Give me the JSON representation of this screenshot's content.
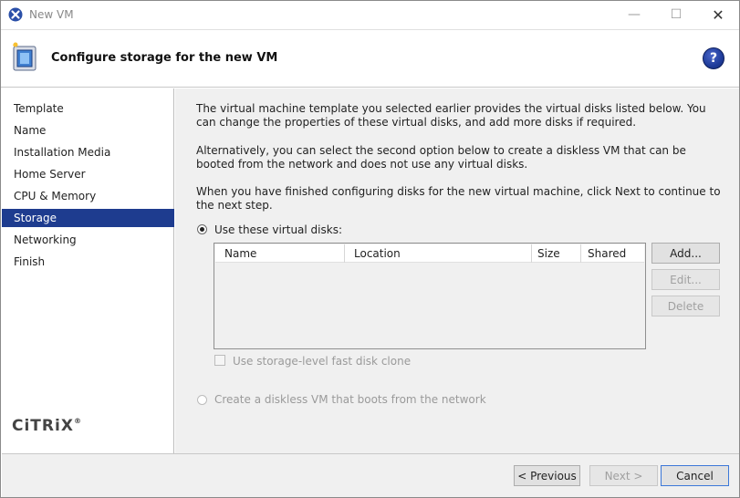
{
  "window": {
    "title": "New VM",
    "minimize_glyph": "—",
    "maximize_glyph": "☐",
    "close_glyph": "✕"
  },
  "header": {
    "title": "Configure storage for the new VM",
    "help_label": "?"
  },
  "sidebar": {
    "items": [
      {
        "label": "Template"
      },
      {
        "label": "Name"
      },
      {
        "label": "Installation Media"
      },
      {
        "label": "Home Server"
      },
      {
        "label": "CPU & Memory"
      },
      {
        "label": "Storage",
        "active": true
      },
      {
        "label": "Networking"
      },
      {
        "label": "Finish"
      }
    ],
    "logo_text": "CiTRiX",
    "logo_mark": "®"
  },
  "main": {
    "intro": "The virtual machine template you selected earlier provides the virtual disks listed below. You can change the properties of these virtual disks, and add more disks if required.",
    "alternative": "Alternatively, you can select the second option below to create a diskless VM that can be booted from the network and does not use any virtual disks.",
    "instructions": "When you have finished configuring disks for the new virtual machine, click Next to continue to the next step.",
    "option_disks_label": "Use these virtual disks:",
    "option_diskless_label": "Create a diskless VM that boots from the network",
    "grid": {
      "columns": [
        "Name",
        "Location",
        "Size",
        "Shared"
      ],
      "rows": []
    },
    "add_label": "Add...",
    "edit_label": "Edit...",
    "delete_label": "Delete",
    "fast_clone_label": "Use storage-level fast disk clone"
  },
  "footer": {
    "previous_label": "< Previous",
    "next_label": "Next >",
    "cancel_label": "Cancel"
  },
  "colors": {
    "accent": "#1e3c8f",
    "panel_bg": "#f0f0f0"
  }
}
